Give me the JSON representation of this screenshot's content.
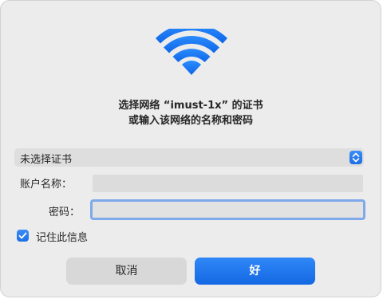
{
  "dialog": {
    "prompt_line1": "选择网络 “imust-1x” 的证书",
    "prompt_line2": "或输入该网络的名称和密码",
    "certificate": {
      "selected": "未选择证书"
    },
    "account": {
      "label": "账户名称：",
      "value": ""
    },
    "password": {
      "label": "密码：",
      "value": ""
    },
    "remember": {
      "label": "记住此信息",
      "checked": true
    },
    "buttons": {
      "cancel": "取消",
      "ok": "好"
    }
  },
  "colors": {
    "accent": "#1a6fe6",
    "dialog_bg": "#ececec",
    "focus_ring": "#7fa9ea"
  },
  "icons": {
    "header": "wifi-icon",
    "select_stepper": "chevron-up-down-icon",
    "checkbox": "checkmark-icon"
  }
}
